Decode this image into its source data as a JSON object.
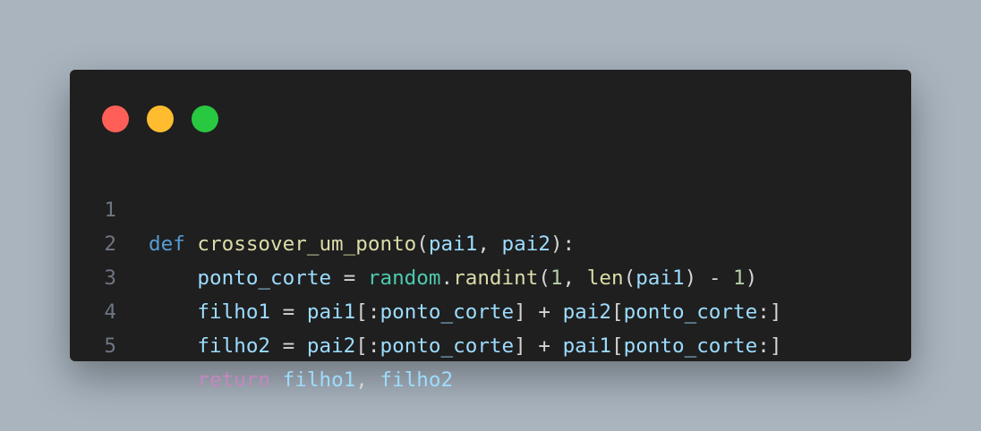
{
  "window": {
    "controls": {
      "close_color": "#ff5f57",
      "minimize_color": "#febc2e",
      "maximize_color": "#28c840"
    }
  },
  "code": {
    "lines": [
      {
        "number": "1",
        "tokens": [
          "def",
          " ",
          "crossover_um_ponto",
          "(",
          "pai1",
          ", ",
          "pai2",
          "):"
        ]
      },
      {
        "number": "2",
        "tokens": [
          "    ",
          "ponto_corte",
          " = ",
          "random",
          ".",
          "randint",
          "(",
          "1",
          ", ",
          "len",
          "(",
          "pai1",
          ") - ",
          "1",
          ")"
        ]
      },
      {
        "number": "3",
        "tokens": [
          "    ",
          "filho1",
          " = ",
          "pai1",
          "[:",
          "ponto_corte",
          "] + ",
          "pai2",
          "[",
          "ponto_corte",
          ":]"
        ]
      },
      {
        "number": "4",
        "tokens": [
          "    ",
          "filho2",
          " = ",
          "pai2",
          "[:",
          "ponto_corte",
          "] + ",
          "pai1",
          "[",
          "ponto_corte",
          ":]"
        ]
      },
      {
        "number": "5",
        "tokens": [
          "    ",
          "return",
          " ",
          "filho1",
          ", ",
          "filho2"
        ]
      }
    ]
  },
  "colors": {
    "background": "#a9b4bf",
    "editor": "#1f1f1f",
    "keyword_def": "#569cd6",
    "keyword_return": "#c586c0",
    "function": "#dcdcaa",
    "variable": "#9cdcfe",
    "module": "#4ec9b0",
    "number": "#b5cea8",
    "punctuation": "#d4d4d4",
    "line_number": "#6e7681"
  }
}
